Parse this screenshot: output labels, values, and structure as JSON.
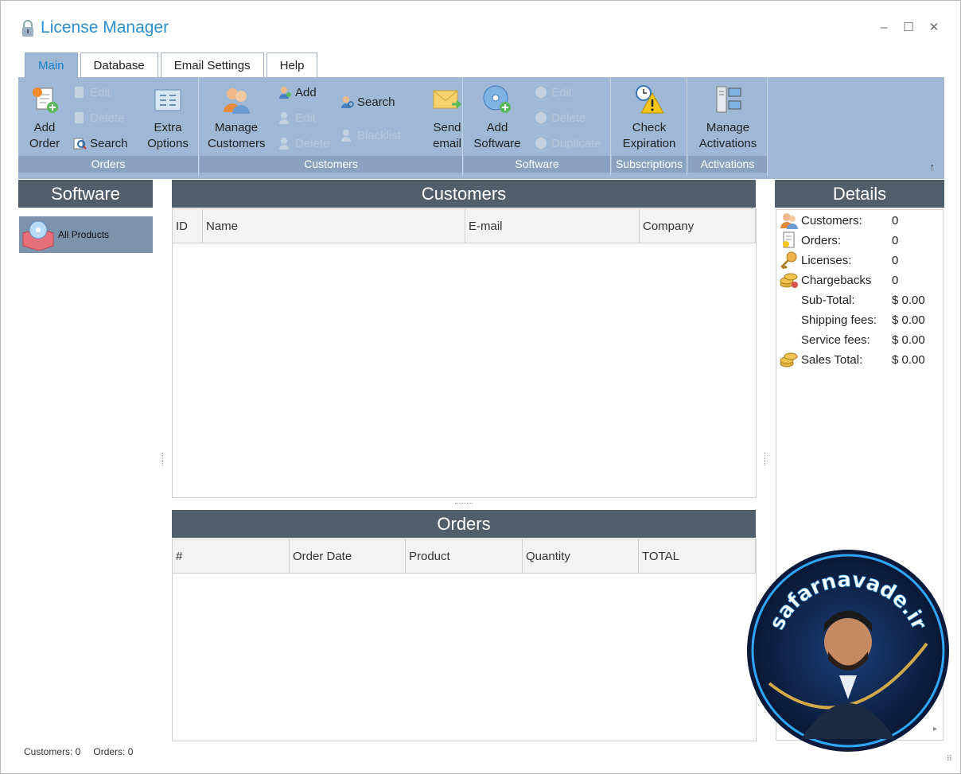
{
  "app": {
    "title": "License Manager"
  },
  "window_controls": {
    "minimize": "–",
    "maximize": "☐",
    "close": "✕"
  },
  "tabs": [
    {
      "label": "Main",
      "active": true
    },
    {
      "label": "Database",
      "active": false
    },
    {
      "label": "Email Settings",
      "active": false
    },
    {
      "label": "Help",
      "active": false
    }
  ],
  "ribbon": {
    "groups": {
      "orders": "Orders",
      "customers": "Customers",
      "software": "Software",
      "subscriptions": "Subscriptions",
      "activations": "Activations"
    },
    "orders": {
      "add_order": "Add Order",
      "edit": "Edit",
      "delete": "Delete",
      "search": "Search",
      "extra_options": "Extra Options"
    },
    "customers": {
      "manage": "Manage Customers",
      "add": "Add",
      "edit": "Edit",
      "delete": "Delete",
      "search": "Search",
      "blacklist": "Blacklist",
      "send_email": "Send email"
    },
    "software": {
      "add": "Add Software",
      "edit": "Edit",
      "delete": "Delete",
      "duplicate": "Duplicate"
    },
    "subscriptions": {
      "check": "Check Expiration"
    },
    "activations": {
      "manage": "Manage Activations"
    },
    "collapse": "↑"
  },
  "software_panel": {
    "title": "Software",
    "items": [
      {
        "label": "All Products"
      }
    ]
  },
  "customers_panel": {
    "title": "Customers",
    "columns": [
      "ID",
      "Name",
      "E-mail",
      "Company"
    ]
  },
  "orders_panel": {
    "title": "Orders",
    "columns": [
      "#",
      "Order Date",
      "Product",
      "Quantity",
      "TOTAL"
    ]
  },
  "details_panel": {
    "title": "Details",
    "rows": [
      {
        "label": "Customers:",
        "value": "0",
        "icon": "customers-icon"
      },
      {
        "label": "Orders:",
        "value": "0",
        "icon": "orders-icon"
      },
      {
        "label": "Licenses:",
        "value": "0",
        "icon": "key-icon"
      },
      {
        "label": "Chargebacks",
        "value": "0",
        "icon": "coins-icon"
      },
      {
        "label": "Sub-Total:",
        "value": "$ 0.00",
        "icon": ""
      },
      {
        "label": "Shipping fees:",
        "value": "$ 0.00",
        "icon": ""
      },
      {
        "label": "Service fees:",
        "value": "$ 0.00",
        "icon": ""
      },
      {
        "label": "Sales Total:",
        "value": "$ 0.00",
        "icon": "coins-icon"
      }
    ]
  },
  "statusbar": {
    "customers": "Customers: 0",
    "orders": "Orders: 0"
  },
  "watermark": {
    "text": "safarnavade.ir"
  },
  "colors": {
    "accent": "#2b8fd0",
    "ribbon": "#9fb8d6",
    "ribbon_label": "#8aa2bf",
    "panel_header": "#515e6c"
  }
}
